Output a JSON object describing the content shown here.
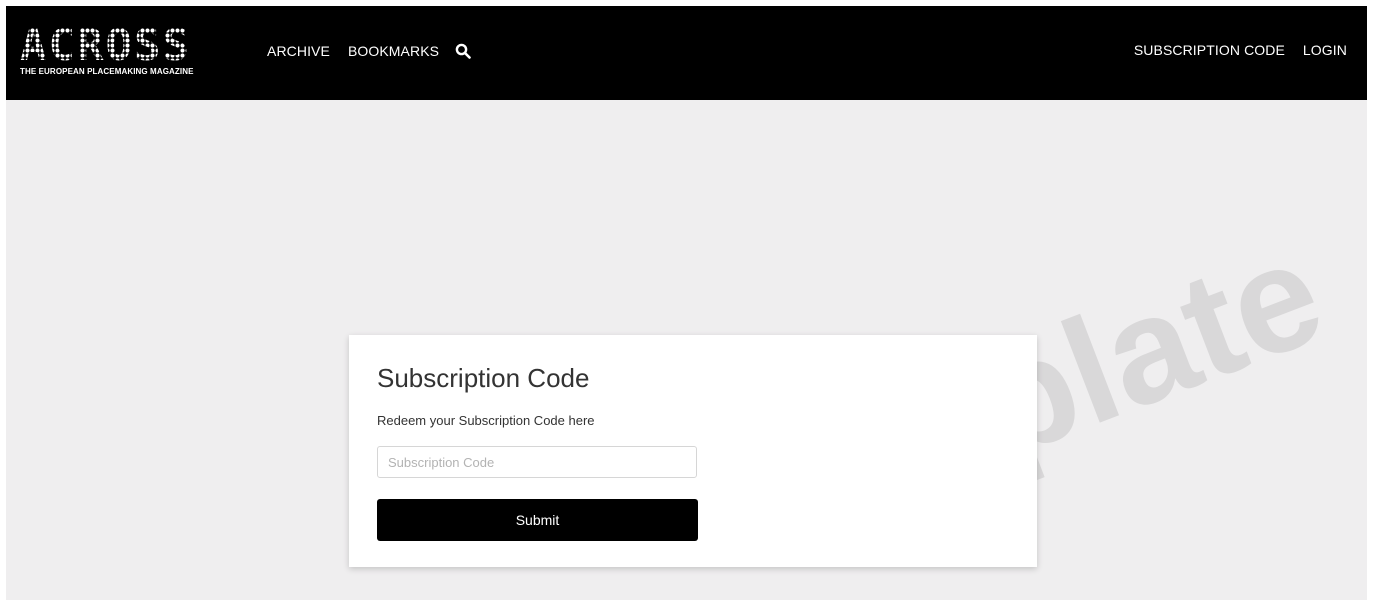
{
  "brand": {
    "logo_text": "ACROSS",
    "tagline": "THE EUROPEAN PLACEMAKING MAGAZINE"
  },
  "nav": {
    "left": [
      {
        "label": "ARCHIVE"
      },
      {
        "label": "BOOKMARKS"
      }
    ],
    "search_icon": "search-icon",
    "right": [
      {
        "label": "SUBSCRIPTION CODE"
      },
      {
        "label": "LOGIN"
      }
    ]
  },
  "watermark": "template",
  "form": {
    "title": "Subscription Code",
    "subtitle": "Redeem your Subscription Code here",
    "input_value": "",
    "input_placeholder": "Subscription Code",
    "submit_label": "Submit"
  },
  "colors": {
    "navbar": "#000000",
    "page_background": "#efeeef",
    "button": "#000000"
  }
}
